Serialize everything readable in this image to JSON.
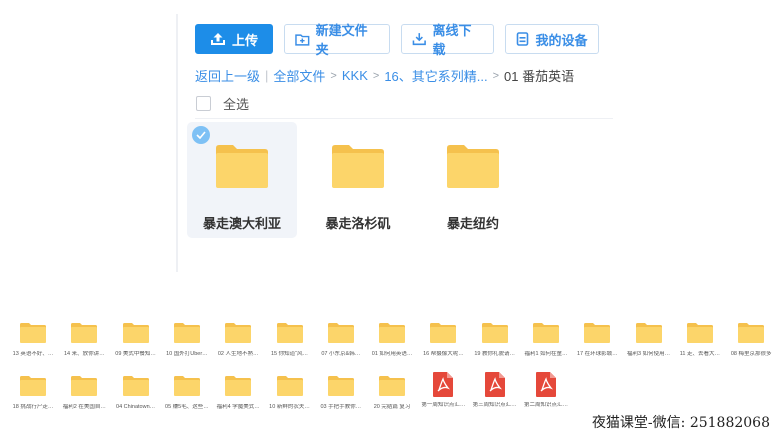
{
  "toolbar": {
    "upload": "上传",
    "new_folder": "新建文件夹",
    "offline_download": "离线下载",
    "my_devices": "我的设备"
  },
  "breadcrumb": {
    "back": "返回上一级",
    "items": [
      "全部文件",
      "KKK",
      "16、其它系列精...",
      "01 番茄英语"
    ]
  },
  "select_all": "全选",
  "folders": [
    {
      "name": "暴走澳大利亚",
      "selected": true
    },
    {
      "name": "暴走洛杉矶",
      "selected": false
    },
    {
      "name": "暴走纽约",
      "selected": false
    }
  ],
  "grid_row1": [
    "13 英语不好、…",
    "14 来、放你讲…",
    "09 美式中餐知…",
    "10 国外打Uber…",
    "02 人生地不熟…",
    "15 你知道“风…",
    "07 小东京&韩…",
    "01 如何用英语…",
    "16 帮摄像大呢…",
    "19 教你礼貌请…",
    "福利1 如何在童…",
    "17 在环球影城…",
    "福利3 如何使用…",
    "11 走、去看大…",
    "08 梅里京那很多"
  ],
  "grid_row2": [
    {
      "label": "18 挑战行尸走…",
      "type": "folder"
    },
    {
      "label": "福利2 在美国自…",
      "type": "folder"
    },
    {
      "label": "04 Chinatown…",
      "type": "folder"
    },
    {
      "label": "05 赚5毛、这些…",
      "type": "folder"
    },
    {
      "label": "福利4 学魔美式…",
      "type": "folder"
    },
    {
      "label": "10 新鲜的农夫…",
      "type": "folder"
    },
    {
      "label": "03 手把手教你…",
      "type": "folder"
    },
    {
      "label": "20 完结篇 复习",
      "type": "folder"
    },
    {
      "label": "第一周知识点汇…",
      "type": "pdf"
    },
    {
      "label": "第三周知识点汇…",
      "type": "pdf"
    },
    {
      "label": "第二周知识点汇…",
      "type": "pdf"
    }
  ],
  "watermark": "夜猫课堂-微信: 251882068",
  "colors": {
    "accent": "#1d8de8",
    "folder": "#fcd56a",
    "folder_dark": "#f5c14d",
    "pdf": "#e5483a"
  }
}
